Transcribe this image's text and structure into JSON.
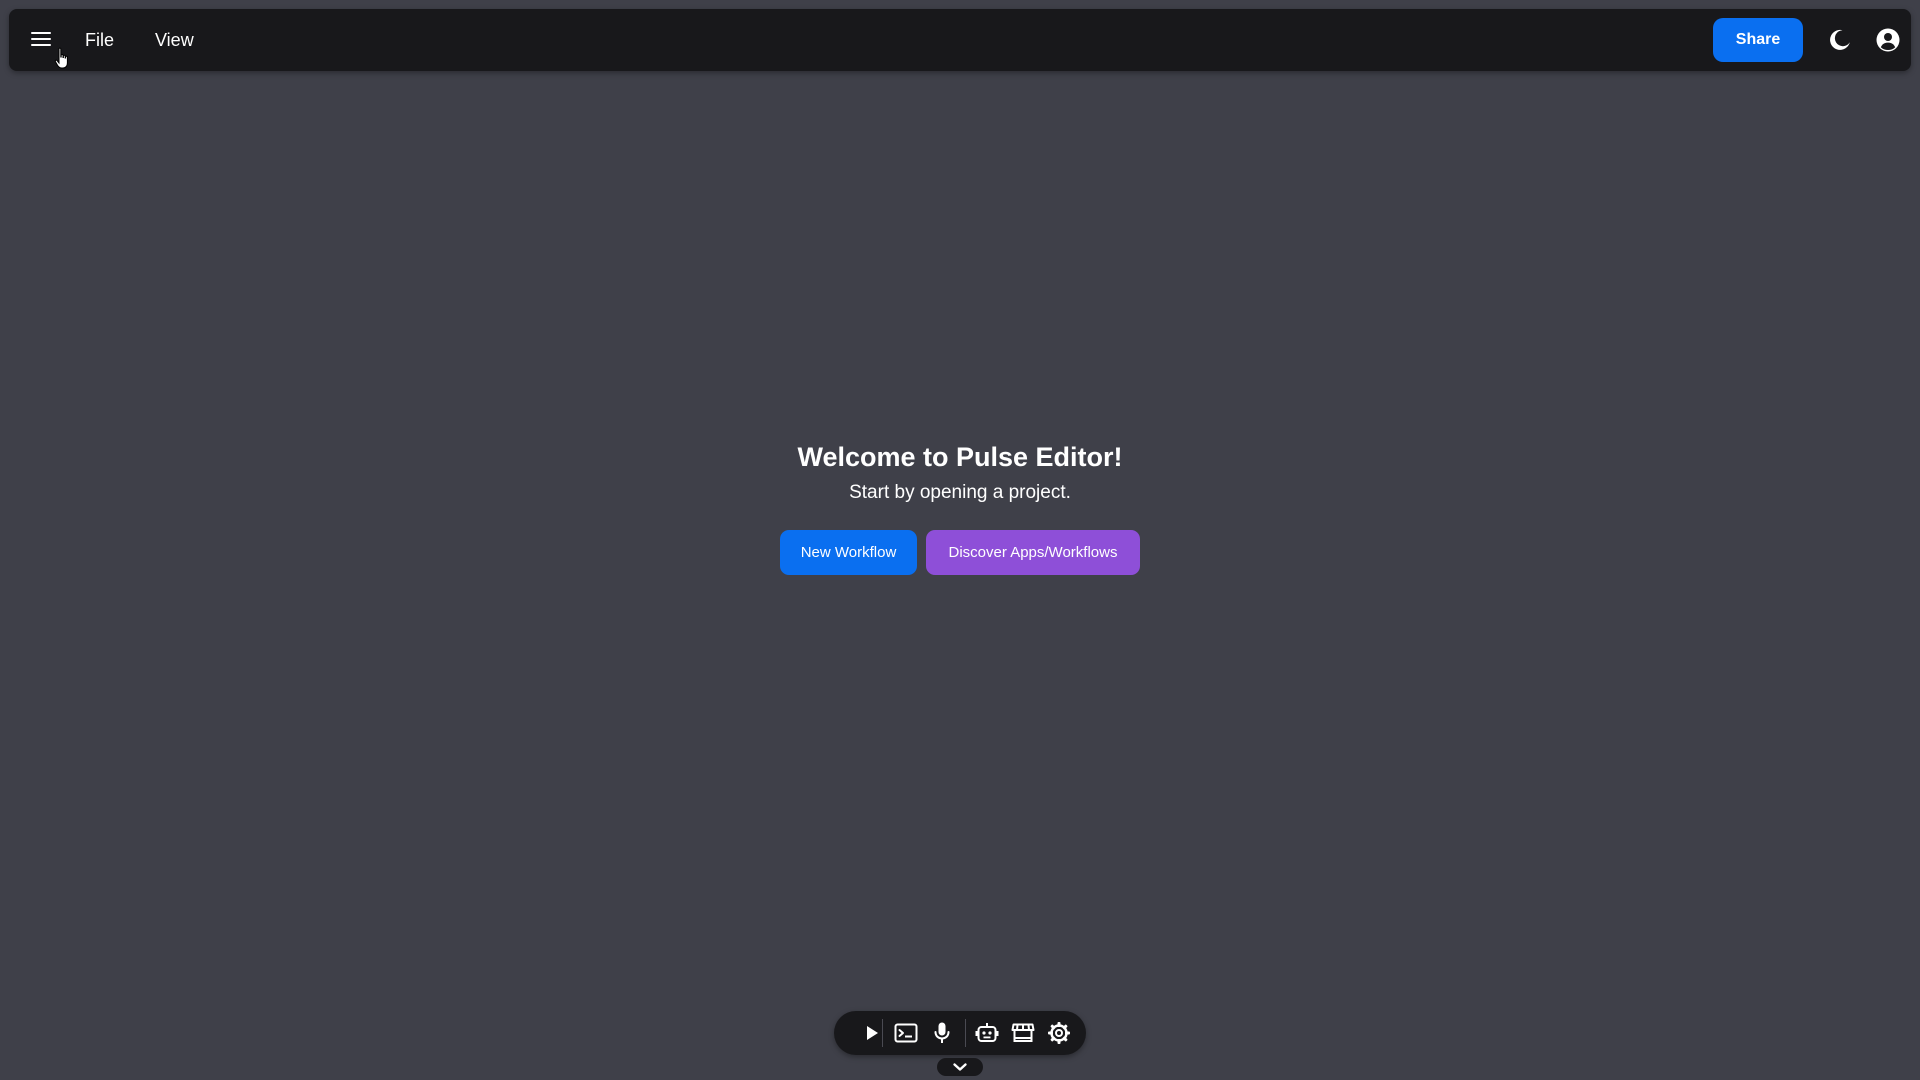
{
  "header": {
    "menu_icon": "hamburger-menu-icon",
    "menus": [
      {
        "label": "File"
      },
      {
        "label": "View"
      }
    ],
    "share_label": "Share",
    "theme_icon": "moon-icon",
    "account_icon": "user-circle-icon"
  },
  "welcome": {
    "title": "Welcome to Pulse Editor!",
    "subtitle": "Start by opening a project.",
    "new_workflow_label": "New Workflow",
    "discover_label": "Discover Apps/Workflows"
  },
  "toolbar": {
    "items": [
      {
        "icon": "play-icon"
      },
      {
        "icon": "terminal-icon"
      },
      {
        "icon": "microphone-icon"
      },
      {
        "icon": "robot-icon"
      },
      {
        "icon": "store-icon"
      },
      {
        "icon": "gear-icon"
      }
    ],
    "collapse_icon": "chevron-down-icon"
  },
  "colors": {
    "background": "#3f4049",
    "bar": "#18181b",
    "primary_blue": "#0a6ff0",
    "purple": "#8e4fd8"
  }
}
